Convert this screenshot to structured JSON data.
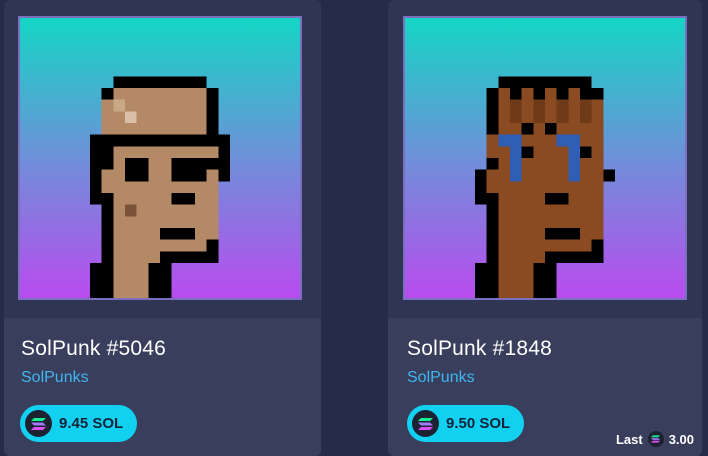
{
  "cards": [
    {
      "title": "SolPunk #5046",
      "collection": "SolPunks",
      "price": "9.45 SOL",
      "icon": "solana-icon",
      "art_colors": {
        "skin": "#b48a66",
        "cap": "#b48a66",
        "glasses": "#000000"
      }
    },
    {
      "title": "SolPunk #1848",
      "collection": "SolPunks",
      "price": "9.50 SOL",
      "icon": "solana-icon",
      "art_colors": {
        "skin": "#8a4b22",
        "tears": "#2f5fb4"
      }
    }
  ],
  "last_sale": {
    "label": "Last",
    "value": "3.00",
    "icon": "solana-icon"
  },
  "colors": {
    "accent_pill": "#11d0f0",
    "collection_link": "#3fb6f0",
    "gradient_top": "#14d6c5",
    "gradient_bottom": "#b84cee"
  }
}
